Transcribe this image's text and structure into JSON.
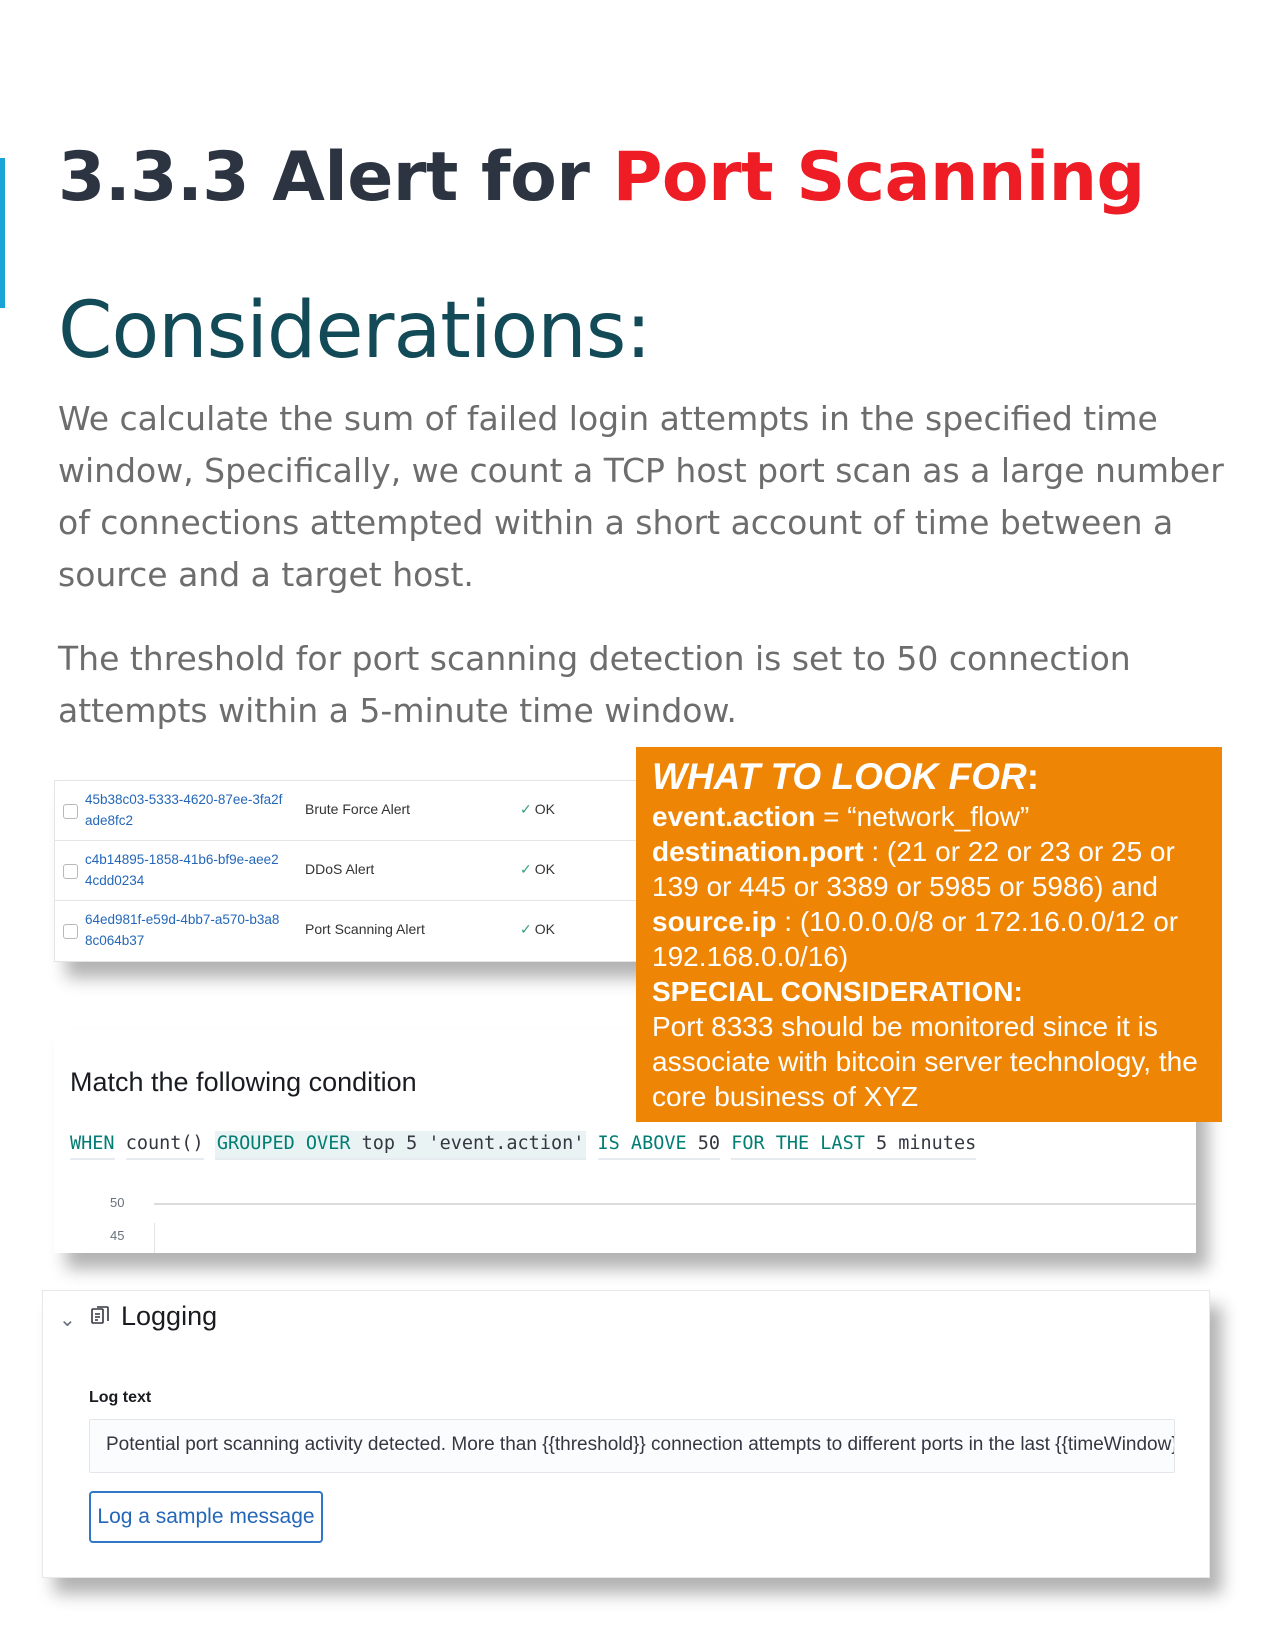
{
  "section": {
    "heading_prefix": "3.3.3 Alert for ",
    "heading_highlight": "Port Scanning",
    "subheading": "Considerations:",
    "paragraph1": "We calculate the sum of failed login attempts in the specified time window, Specifically, we count a TCP host port scan as a large number of connections attempted within a short account of time between a source and a target host.",
    "paragraph2": "The threshold for port scanning detection is set to 50 connection attempts within a 5-minute time window."
  },
  "alerts": [
    {
      "id": "45b38c03-5333-4620-87ee-3fa2fade8fc2",
      "name": "Brute Force Alert",
      "status": "OK"
    },
    {
      "id": "c4b14895-1858-41b6-bf9e-aee24cdd0234",
      "name": "DDoS Alert",
      "status": "OK"
    },
    {
      "id": "64ed981f-e59d-4bb7-a570-b3a88c064b37",
      "name": "Port Scanning Alert",
      "status": "OK"
    }
  ],
  "look_for": {
    "title": "WHAT TO LOOK FOR",
    "title_colon": ":",
    "action_key": "event.action",
    "action_value": " = “network_flow”",
    "port_key": "destination.port",
    "port_value": " : (21 or 22 or 23 or 25 or 139 or 445 or 3389 or 5985 or 5986) and",
    "ip_key": "source.ip",
    "ip_value": " : (10.0.0.0/8 or 172.16.0.0/12 or 192.168.0.0/16)",
    "special_title": "SPECIAL CONSIDERATION:",
    "special_text": "Port  8333 should be monitored since it is associate with bitcoin server technology, the core  business of XYZ"
  },
  "condition": {
    "title": "Match the following condition",
    "when": "WHEN",
    "agg": "count()",
    "grouped": "GROUPED OVER",
    "top": "top 5 'event.action'",
    "is_above": "IS ABOVE",
    "threshold": "50",
    "for_the_last": "FOR THE LAST",
    "window": "5 minutes",
    "y_tick_top": "50",
    "y_tick_next": "45"
  },
  "logging": {
    "title": "Logging",
    "label": "Log text",
    "log_text": "Potential port scanning activity detected. More than {{threshold}} connection attempts to different ports in the last {{timeWindow}}",
    "button": "Log a sample message"
  },
  "colors": {
    "heading_highlight": "#ee1c24",
    "accent_bar": "#1aa3d6",
    "orange_box": "#ef8504",
    "subheading": "#134a58",
    "keyword": "#017d73",
    "link": "#2467b8"
  }
}
